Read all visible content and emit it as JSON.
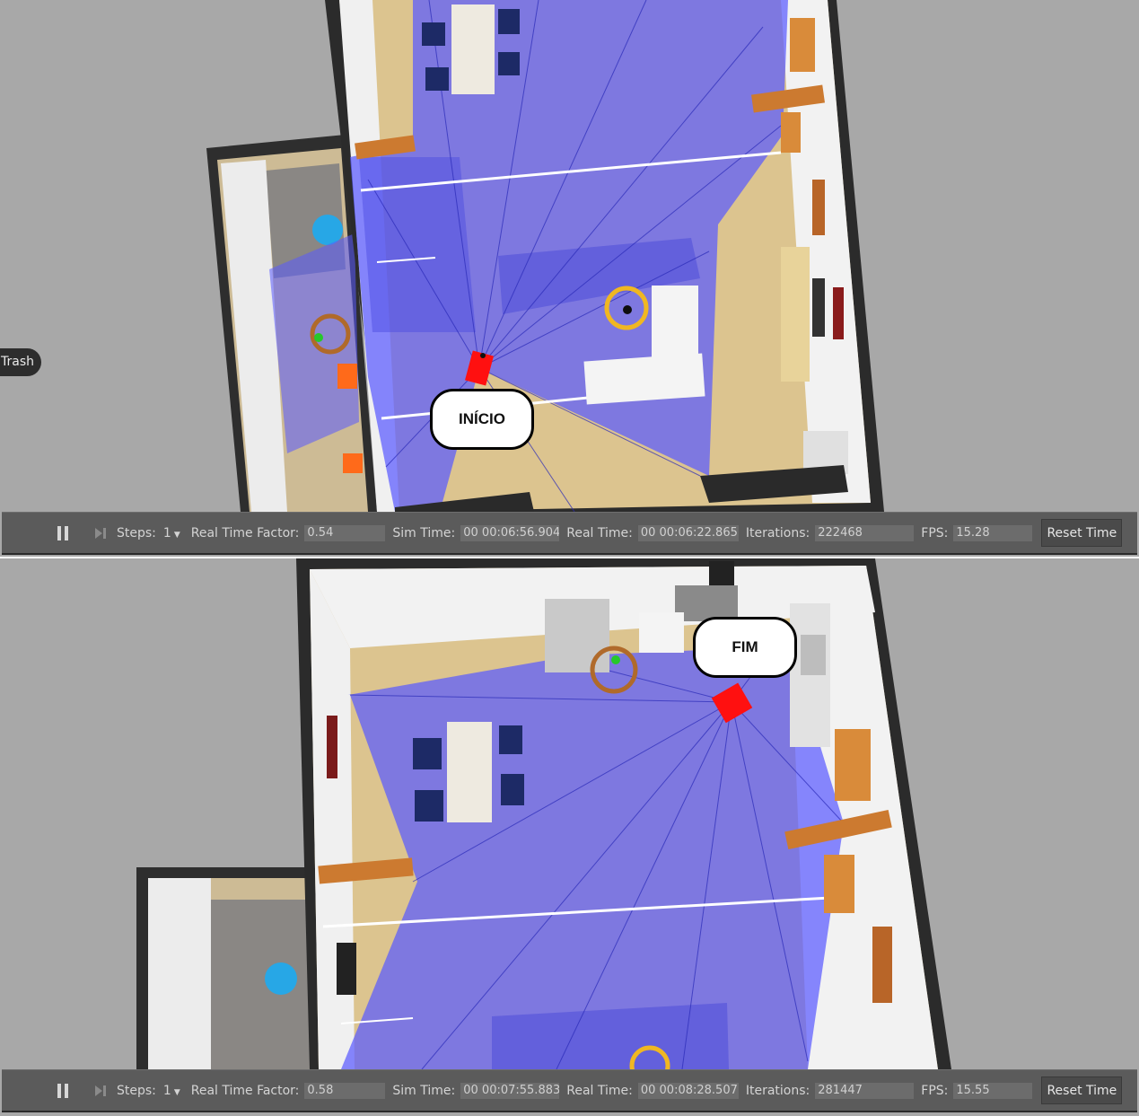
{
  "panels": [
    {
      "callout": "INÍCIO",
      "trash_label": "Trash",
      "toolbar": {
        "steps_label": "Steps:",
        "steps_value": "1",
        "rtf_label": "Real Time Factor:",
        "rtf_value": "0.54",
        "sim_time_label": "Sim Time:",
        "sim_time_value": "00 00:06:56.904",
        "real_time_label": "Real Time:",
        "real_time_value": "00 00:06:22.865",
        "iterations_label": "Iterations:",
        "iterations_value": "222468",
        "fps_label": "FPS:",
        "fps_value": "15.28",
        "reset_label": "Reset Time"
      }
    },
    {
      "callout": "FIM",
      "toolbar": {
        "steps_label": "Steps:",
        "steps_value": "1",
        "rtf_label": "Real Time Factor:",
        "rtf_value": "0.58",
        "sim_time_label": "Sim Time:",
        "sim_time_value": "00 00:07:55.883",
        "real_time_label": "Real Time:",
        "real_time_value": "00 00:08:28.507",
        "iterations_label": "Iterations:",
        "iterations_value": "281447",
        "fps_label": "FPS:",
        "fps_value": "15.55",
        "reset_label": "Reset Time"
      }
    }
  ],
  "colors": {
    "background": "#a8a8a8",
    "floor": "#d9c08a",
    "laser": "#5a5aff",
    "robot": "#ff1010",
    "toolbar": "#5b5b5b"
  }
}
